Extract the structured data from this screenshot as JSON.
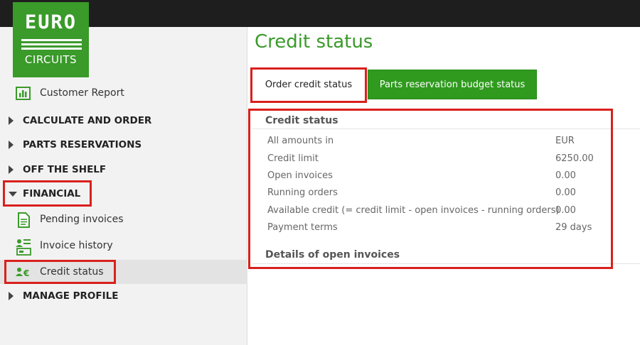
{
  "brand": {
    "top": "EURO",
    "bottom": "CIRCUITS"
  },
  "sidebar": {
    "customer_report": "Customer Report",
    "sections": {
      "calculate": "CALCULATE AND ORDER",
      "parts": "PARTS RESERVATIONS",
      "shelf": "OFF THE SHELF",
      "financial": "FINANCIAL",
      "profile": "MANAGE PROFILE"
    },
    "financial_items": {
      "pending": "Pending invoices",
      "history": "Invoice history",
      "credit": "Credit status"
    }
  },
  "main": {
    "title": "Credit status",
    "tabs": {
      "order": "Order credit status",
      "parts": "Parts reservation budget status"
    },
    "panel": {
      "heading": "Credit status",
      "rows": [
        {
          "label": "All amounts in",
          "value": "EUR"
        },
        {
          "label": "Credit limit",
          "value": "6250.00"
        },
        {
          "label": "Open invoices",
          "value": "0.00"
        },
        {
          "label": "Running orders",
          "value": "0.00"
        },
        {
          "label": "Available credit (= credit limit - open invoices - running orders)",
          "value": "0.00"
        },
        {
          "label": "Payment terms",
          "value": "29 days"
        }
      ],
      "details_heading": "Details of open invoices"
    }
  },
  "colors": {
    "brand_green": "#3a9a2a",
    "highlight_red": "#d9201c",
    "top_bar": "#1e1e1e"
  }
}
